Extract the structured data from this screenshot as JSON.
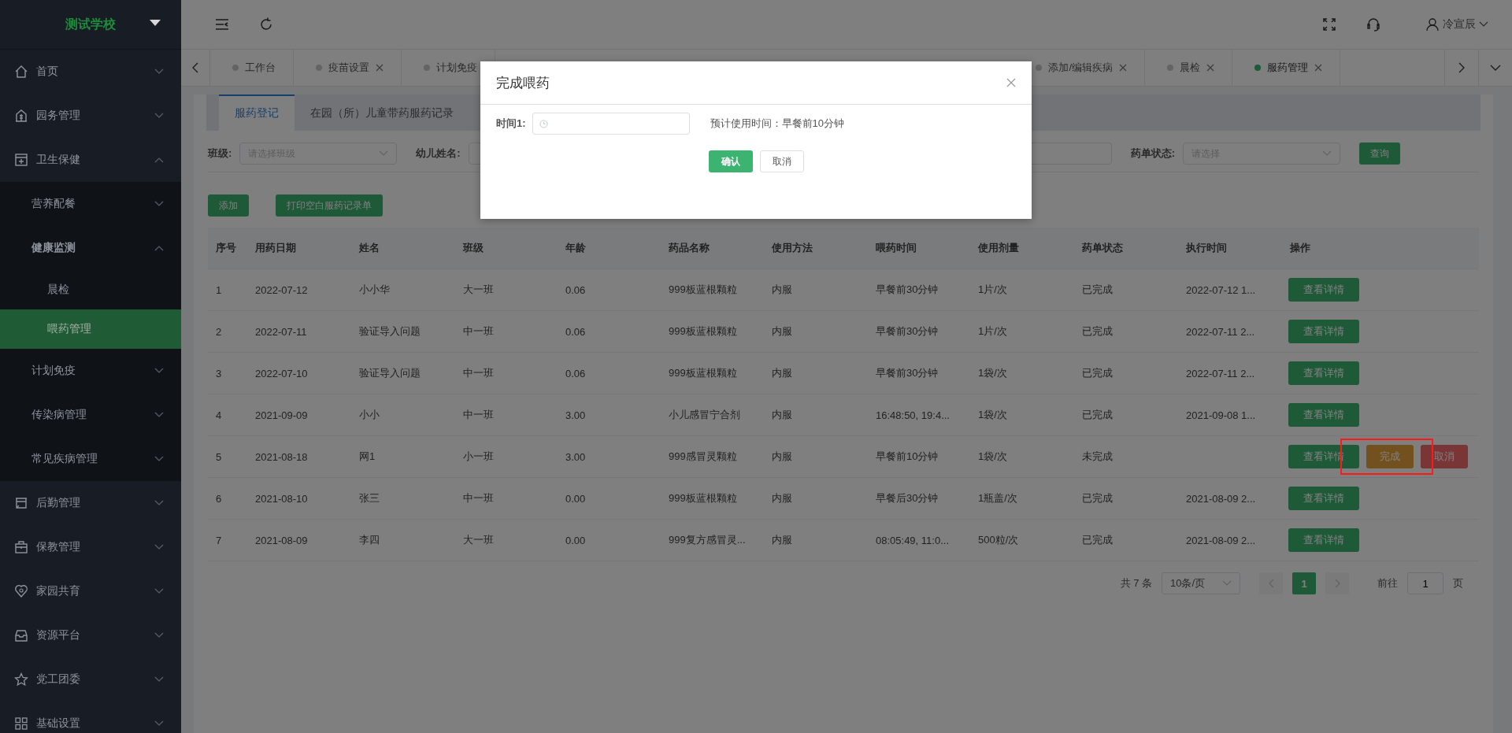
{
  "sidebar": {
    "logo": "测试学校",
    "items": [
      {
        "label": "首页",
        "expanded": false,
        "selected": false
      },
      {
        "label": "园务管理",
        "expanded": false,
        "selected": false
      },
      {
        "label": "卫生保健",
        "expanded": true,
        "selected": false,
        "children": [
          {
            "label": "营养配餐",
            "expanded": false,
            "selected": false
          },
          {
            "label": "健康监测",
            "expanded": true,
            "selected": false,
            "children": [
              {
                "label": "晨检",
                "selected": false
              },
              {
                "label": "喂药管理",
                "selected": true
              }
            ]
          },
          {
            "label": "计划免疫",
            "expanded": false,
            "selected": false
          },
          {
            "label": "传染病管理",
            "expanded": false,
            "selected": false
          },
          {
            "label": "常见疾病管理",
            "expanded": false,
            "selected": false
          }
        ]
      },
      {
        "label": "后勤管理",
        "expanded": false,
        "selected": false
      },
      {
        "label": "保教管理",
        "expanded": false,
        "selected": false
      },
      {
        "label": "家园共育",
        "expanded": false,
        "selected": false
      },
      {
        "label": "资源平台",
        "expanded": false,
        "selected": false
      },
      {
        "label": "党工团委",
        "expanded": false,
        "selected": false
      },
      {
        "label": "基础设置",
        "expanded": false,
        "selected": false
      }
    ]
  },
  "header": {
    "user_name": "冷宣辰"
  },
  "page_tabs": {
    "left": [
      {
        "label": "工作台",
        "closable": false,
        "selected": false
      },
      {
        "label": "疫苗设置",
        "closable": true,
        "selected": false
      },
      {
        "label": "计划免疫",
        "closable": false,
        "selected": false
      }
    ],
    "right": [
      {
        "label": "添加/编辑疾病",
        "closable": true,
        "selected": false
      },
      {
        "label": "晨检",
        "closable": true,
        "selected": false
      },
      {
        "label": "服药管理",
        "closable": true,
        "selected": true
      }
    ]
  },
  "content_tabs": [
    {
      "label": "服药登记",
      "selected": true
    },
    {
      "label": "在园（所）儿童带药服药记录",
      "selected": false
    }
  ],
  "filters": [
    {
      "label": "班级:",
      "kind": "select",
      "placeholder": "请选择班级"
    },
    {
      "label": "幼儿姓名:",
      "kind": "input"
    },
    {
      "label": "药单状态:",
      "kind": "select",
      "placeholder": "请选择"
    }
  ],
  "search_button": "查询",
  "actions": [
    "添加",
    "打印空白服药记录单"
  ],
  "table": {
    "columns": [
      "序号",
      "用药日期",
      "姓名",
      "班级",
      "年龄",
      "药品名称",
      "使用方法",
      "喂药时间",
      "使用剂量",
      "药单状态",
      "执行时间",
      "操作"
    ],
    "rows": [
      {
        "cells": [
          "1",
          "2022-07-12",
          "小小华",
          "大一班",
          "0.06",
          "999板蓝根颗粒",
          "内服",
          "早餐前30分钟",
          "1片/次",
          "已完成",
          "2022-07-12 1..."
        ],
        "actions": [
          {
            "label": "查看详情",
            "kind": "view"
          }
        ],
        "annotated": false
      },
      {
        "cells": [
          "2",
          "2022-07-11",
          "验证导入问题",
          "中一班",
          "0.06",
          "999板蓝根颗粒",
          "内服",
          "早餐前30分钟",
          "1片/次",
          "已完成",
          "2022-07-11 2..."
        ],
        "actions": [
          {
            "label": "查看详情",
            "kind": "view"
          }
        ],
        "annotated": false
      },
      {
        "cells": [
          "3",
          "2022-07-10",
          "验证导入问题",
          "中一班",
          "0.06",
          "999板蓝根颗粒",
          "内服",
          "早餐前30分钟",
          "1袋/次",
          "已完成",
          "2022-07-11 2..."
        ],
        "actions": [
          {
            "label": "查看详情",
            "kind": "view"
          }
        ],
        "annotated": false
      },
      {
        "cells": [
          "4",
          "2021-09-09",
          "小小",
          "中一班",
          "3.00",
          "小儿感冒宁合剂",
          "内服",
          "16:48:50, 19:4...",
          "1袋/次",
          "已完成",
          "2021-09-08 1..."
        ],
        "actions": [
          {
            "label": "查看详情",
            "kind": "view"
          }
        ],
        "annotated": false
      },
      {
        "cells": [
          "5",
          "2021-08-18",
          "网1",
          "小一班",
          "3.00",
          "999感冒灵颗粒",
          "内服",
          "早餐前10分钟",
          "1袋/次",
          "未完成"
        ],
        "actions": [
          {
            "label": "查看详情",
            "kind": "view"
          },
          {
            "label": "完成",
            "kind": "complete"
          },
          {
            "label": "取消",
            "kind": "cancel"
          }
        ],
        "annotated": true
      },
      {
        "cells": [
          "6",
          "2021-08-10",
          "张三",
          "中一班",
          "0.00",
          "999板蓝根颗粒",
          "内服",
          "早餐后30分钟",
          "1瓶盖/次",
          "已完成",
          "2021-08-09 2..."
        ],
        "actions": [
          {
            "label": "查看详情",
            "kind": "view"
          }
        ],
        "annotated": false
      },
      {
        "cells": [
          "7",
          "2021-08-09",
          "李四",
          "大一班",
          "0.00",
          "999复方感冒灵...",
          "内服",
          "08:05:49, 11:0...",
          "500粒/次",
          "已完成",
          "2021-08-09 2..."
        ],
        "actions": [
          {
            "label": "查看详情",
            "kind": "view"
          }
        ],
        "annotated": false
      }
    ]
  },
  "pagination": {
    "total": "共 7 条",
    "page_size": "10条/页",
    "pages": [
      {
        "label": "1",
        "selected": true
      }
    ],
    "goto_label": "前往",
    "goto_value": "1",
    "goto_unit": "页"
  },
  "dialog": {
    "title": "完成喂药",
    "field_label": "时间1:",
    "hint": "预计使用时间：早餐前10分钟",
    "buttons": [
      {
        "label": "确认",
        "kind": "primary"
      },
      {
        "label": "取消",
        "kind": "default"
      }
    ]
  }
}
